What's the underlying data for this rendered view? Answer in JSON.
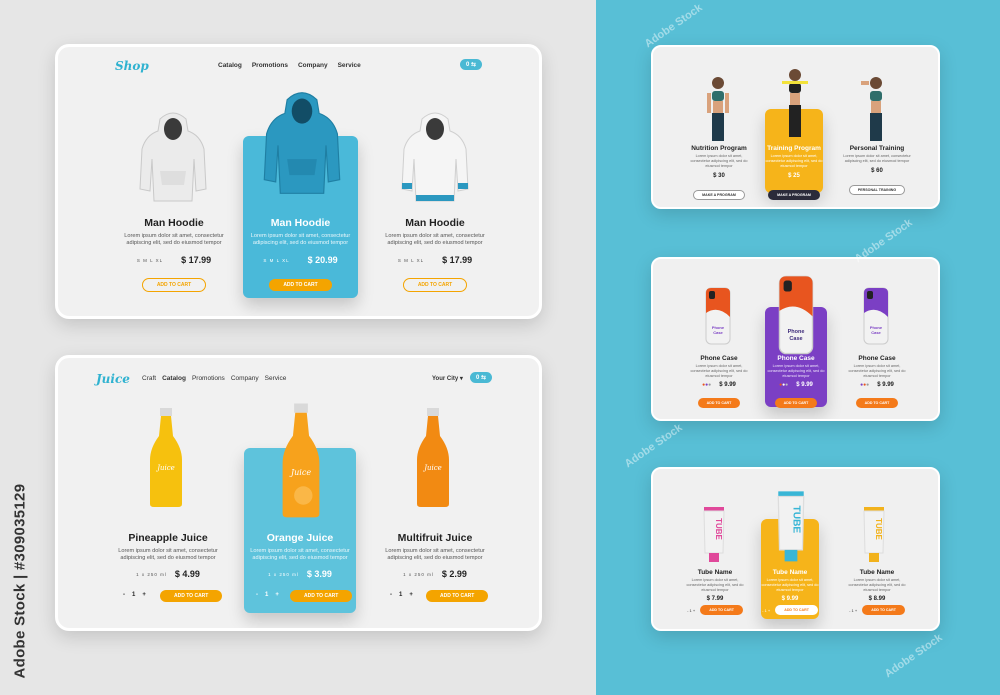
{
  "watermark": {
    "side_text": "Adobe Stock | #309035129",
    "stamp_text": "Adobe Stock"
  },
  "shop": {
    "logo": "Shop",
    "menu": [
      "Catalog",
      "Promotions",
      "Company",
      "Service"
    ],
    "cart_count": "0",
    "cart_label": "0 ⇆",
    "products": [
      {
        "name": "Man Hoodie",
        "desc": "Lorem ipsum dolor sit amet, consectetur adipiscing elit, sed do eiusmod tempor",
        "sizes": "S M L XL",
        "price": "$ 17.99",
        "button": "ADD TO CART",
        "color": "#f2f2f2"
      },
      {
        "name": "Man Hoodie",
        "desc": "Lorem ipsum dolor sit amet, consectetur adipiscing elit, sed do eiusmod tempor",
        "sizes": "S M L XL",
        "price": "$ 20.99",
        "button": "ADD TO CART",
        "color": "#2b98c0"
      },
      {
        "name": "Man Hoodie",
        "desc": "Lorem ipsum dolor sit amet, consectetur adipiscing elit, sed do eiusmod tempor",
        "sizes": "S M L XL",
        "price": "$ 17.99",
        "button": "ADD TO CART",
        "color": "#f5f5f5"
      }
    ],
    "highlight_color": "#4ab9d9"
  },
  "juice": {
    "logo": "Juice",
    "menu": [
      "Craft",
      "Catalog",
      "Promotions",
      "Company",
      "Service"
    ],
    "city": "Your City ▾",
    "cart_label": "0 ⇆",
    "products": [
      {
        "name": "Pineapple Juice",
        "desc": "Lorem ipsum dolor sit amet, consectetur adipiscing elit, sed do eiusmod tempor",
        "volume": "1 x 250 ml",
        "price": "$ 4.99",
        "qty": "1",
        "minus": "-",
        "plus": "+",
        "button": "ADD TO CART",
        "bottle": "#f6c10e"
      },
      {
        "name": "Orange Juice",
        "desc": "Lorem ipsum dolor sit amet, consectetur adipiscing elit, sed do eiusmod tempor",
        "volume": "1 x 250 ml",
        "price": "$ 3.99",
        "qty": "1",
        "minus": "-",
        "plus": "+",
        "button": "ADD TO CART",
        "bottle": "#f7a21c"
      },
      {
        "name": "Multifruit Juice",
        "desc": "Lorem ipsum dolor sit amet, consectetur adipiscing elit, sed do eiusmod tempor",
        "volume": "1 x 250 ml",
        "price": "$ 2.99",
        "qty": "1",
        "minus": "-",
        "plus": "+",
        "button": "ADD TO CART",
        "bottle": "#f28a12"
      }
    ],
    "bottle_label": "Juice",
    "highlight_color": "#5ec3dc"
  },
  "fitness": {
    "products": [
      {
        "name": "Nutrition Program",
        "desc": "Lorem ipsum dolor sit amet, consectetur adipiscing elit, sed do eiusmod tempor",
        "price": "$ 30",
        "button": "MAKE A PROGRAM"
      },
      {
        "name": "Training Program",
        "desc": "Lorem ipsum dolor sit amet, consectetur adipiscing elit, sed do eiusmod tempor",
        "price": "$ 25",
        "button": "MAKE A PROGRAM"
      },
      {
        "name": "Personal Training",
        "desc": "Lorem ipsum dolor sit amet, consectetur adipiscing elit, sed do eiusmod tempor",
        "price": "$ 60",
        "button": "PERSONAL TRAINING"
      }
    ],
    "highlight_color": "#f6b41a"
  },
  "phone": {
    "products": [
      {
        "name": "Phone Case",
        "desc": "Lorem ipsum dolor sit amet, consectetur adipiscing elit, sed do eiusmod tempor",
        "price": "$ 9.99",
        "button": "ADD TO CART",
        "case_label": "Phone Case"
      },
      {
        "name": "Phone Case",
        "desc": "Lorem ipsum dolor sit amet, consectetur adipiscing elit, sed do eiusmod tempor",
        "price": "$ 9.99",
        "button": "ADD TO CART",
        "case_label": "Phone Case"
      },
      {
        "name": "Phone Case",
        "desc": "Lorem ipsum dolor sit amet, consectetur adipiscing elit, sed do eiusmod tempor",
        "price": "$ 9.99",
        "button": "ADD TO CART",
        "case_label": "Phone Case"
      }
    ],
    "highlight_color": "#7b3fc4"
  },
  "tube": {
    "products": [
      {
        "name": "Tube Name",
        "desc": "Lorem ipsum dolor sit amet, consectetur adipiscing elit, sed do eiusmod tempor",
        "price": "$ 7.99",
        "qty": "1",
        "button": "ADD TO CART",
        "tube_label": "TUBE",
        "color": "#e0489a"
      },
      {
        "name": "Tube Name",
        "desc": "Lorem ipsum dolor sit amet, consectetur adipiscing elit, sed do eiusmod tempor",
        "price": "$ 9.99",
        "qty": "1",
        "button": "ADD TO CART",
        "tube_label": "TUBE",
        "color": "#39b6d6"
      },
      {
        "name": "Tube Name",
        "desc": "Lorem ipsum dolor sit amet, consectetur adipiscing elit, sed do eiusmod tempor",
        "price": "$ 8.99",
        "qty": "1",
        "button": "ADD TO CART",
        "tube_label": "TUBE",
        "color": "#f2b21c"
      }
    ],
    "highlight_color": "#f6b41a"
  }
}
